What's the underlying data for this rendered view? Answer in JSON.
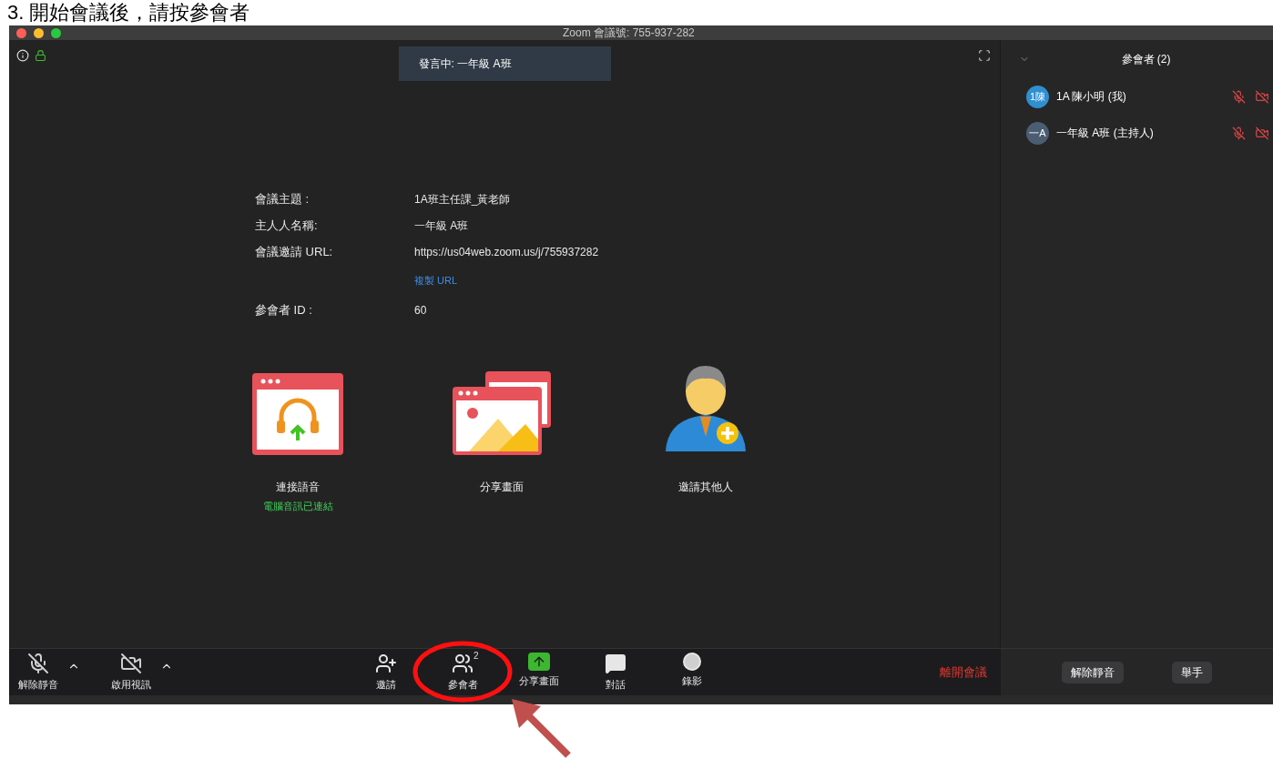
{
  "heading": "3. 開始會議後，請按參會者",
  "window": {
    "title": "Zoom 會議號: 755-937-282"
  },
  "speaker_banner": "發言中: 一年級 A班",
  "meeting_info": [
    {
      "label": "會議主題 :",
      "value": "1A班主任課_黃老師"
    },
    {
      "label": "主人人名稱:",
      "value": "一年級 A班"
    },
    {
      "label": "會議邀請 URL:",
      "value": "https://us04web.zoom.us/j/755937282",
      "link": "複製 URL"
    },
    {
      "label": "參會者 ID :",
      "value": "60"
    }
  ],
  "actions": [
    {
      "kind": "audio",
      "label": "連接語音",
      "status": "電腦音訊已連結"
    },
    {
      "kind": "share",
      "label": "分享畫面"
    },
    {
      "kind": "invite",
      "label": "邀請其他人"
    }
  ],
  "toolbar": {
    "left": [
      {
        "kind": "mic",
        "label": "解除靜音",
        "off": true
      },
      {
        "kind": "video",
        "label": "啟用視訊",
        "off": true
      }
    ],
    "center": [
      {
        "kind": "invite",
        "label": "邀請"
      },
      {
        "kind": "participants",
        "label": "參會者",
        "badge": "2"
      },
      {
        "kind": "share",
        "label": "分享畫面"
      },
      {
        "kind": "chat",
        "label": "對話"
      },
      {
        "kind": "record",
        "label": "錄影"
      }
    ],
    "leave": "離開會議"
  },
  "participants_panel": {
    "title": "參會者 (2)",
    "participants": [
      {
        "avatar": "1陳",
        "name": "1A 陳小明 (我)",
        "color": "#2f8fd0",
        "mic_muted": true,
        "video_off": true
      },
      {
        "avatar": "一A",
        "name": "一年級 A班 (主持人)",
        "color": "#4a5d73",
        "mic_muted": true,
        "video_off": true
      }
    ],
    "buttons": [
      "解除靜音",
      "舉手"
    ]
  }
}
